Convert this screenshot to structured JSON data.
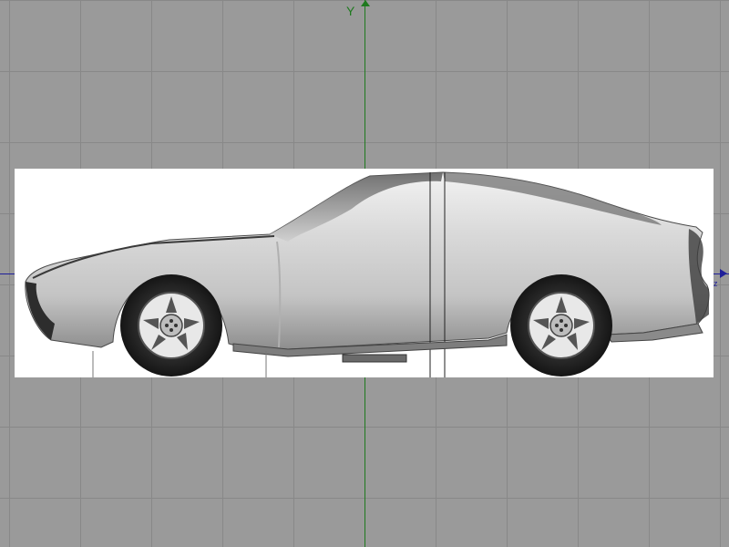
{
  "viewport": {
    "axis_y_label": "Y",
    "axis_z_label": "z",
    "grid_color": "#888888",
    "background_color": "#9a9a9a",
    "axis_y_color": "#1f7a1f",
    "axis_z_color": "#1f1f9a"
  },
  "blueprint": {
    "subject": "car-side-view",
    "image_name": "car-blueprint-image"
  }
}
